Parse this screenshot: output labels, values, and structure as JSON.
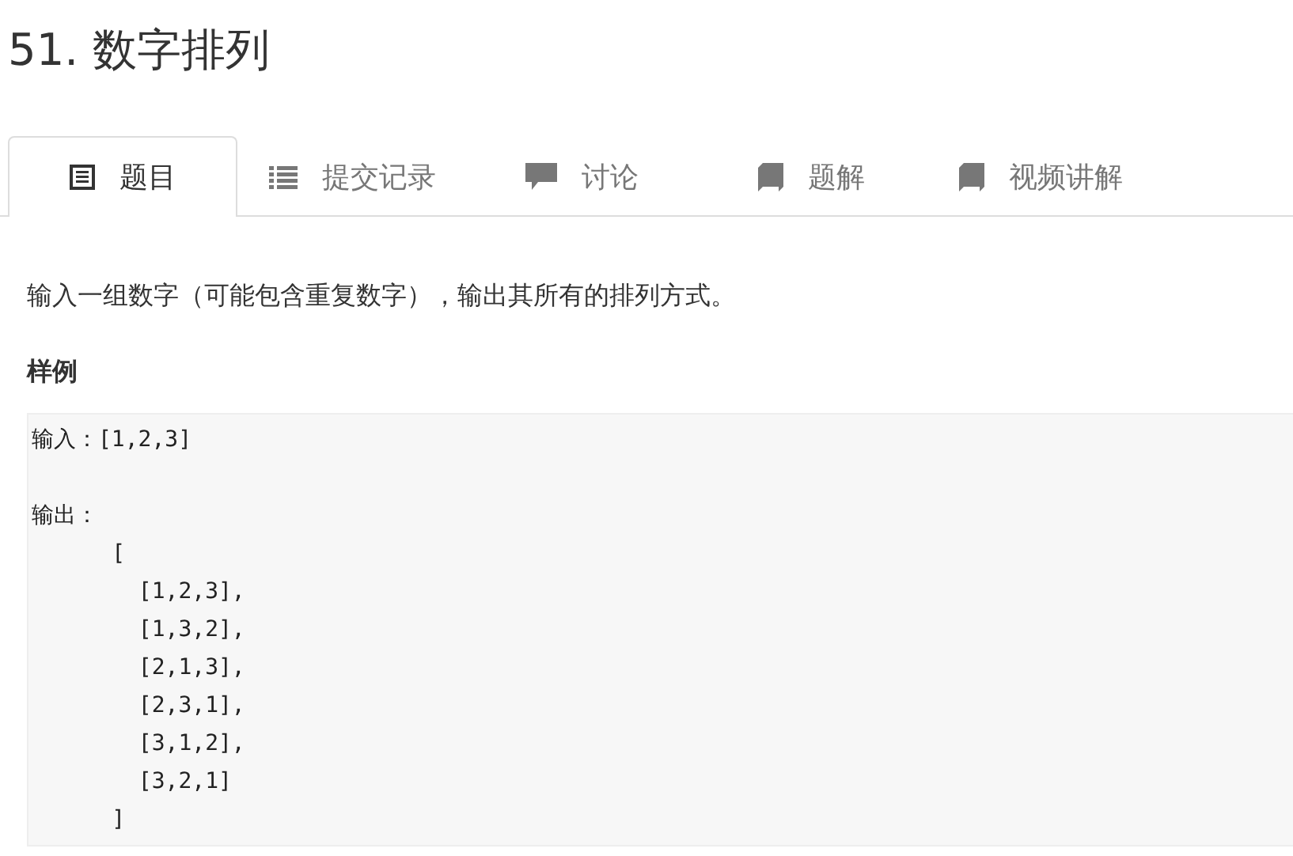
{
  "title": "51. 数字排列",
  "tabs": [
    {
      "label": "题目",
      "kind": "document",
      "selected": true
    },
    {
      "label": "提交记录",
      "kind": "list",
      "selected": false
    },
    {
      "label": "讨论",
      "kind": "comment",
      "selected": false
    },
    {
      "label": "题解",
      "kind": "book",
      "selected": false
    },
    {
      "label": "视频讲解",
      "kind": "book",
      "selected": false
    }
  ],
  "description": "输入一组数字（可能包含重复数字），输出其所有的排列方式。",
  "sample_heading": "样例",
  "sample_code": "输入：[1,2,3]\n\n输出：\n      [\n        [1,2,3],\n        [1,3,2],\n        [2,1,3],\n        [2,3,1],\n        [3,1,2],\n        [3,2,1]\n      ]"
}
